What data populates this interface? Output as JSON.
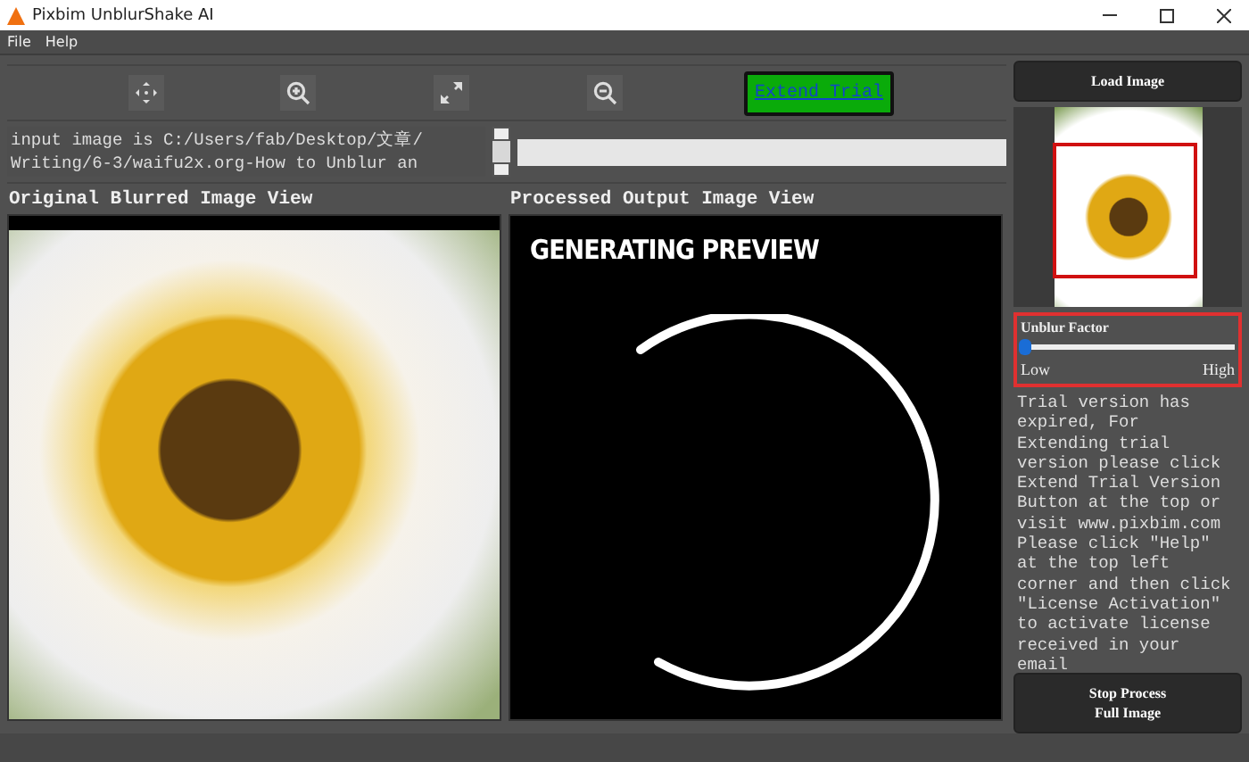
{
  "window": {
    "title": "Pixbim UnblurShake AI"
  },
  "menu": [
    "File",
    "Help"
  ],
  "toolbar": {
    "extend_button": "Extend Trial"
  },
  "log_text": "input image is C:/Users/fab/Desktop/文章/\nWriting/6-3/waifu2x.org-How to Unblur an",
  "progress": {
    "level": 0
  },
  "views": [
    {
      "title": "Original Blurred Image View",
      "kind": "photo"
    },
    {
      "title": "Processed Output Image View",
      "kind": "preview",
      "overlay": "GENERATING PREVIEW"
    }
  ],
  "side": {
    "load_button": "Load Image",
    "slider": {
      "label": "Unblur Factor",
      "level": 0,
      "low": "Low",
      "high": "High"
    },
    "message": "Trial version has expired, For Extending trial version please click Extend Trial Version Button at the top or visit www.pixbim.com Please click \"Help\" at the top left corner and then click \"License Activation\" to activate license received in your email",
    "stop_button": "Stop Process\nFull Image"
  }
}
